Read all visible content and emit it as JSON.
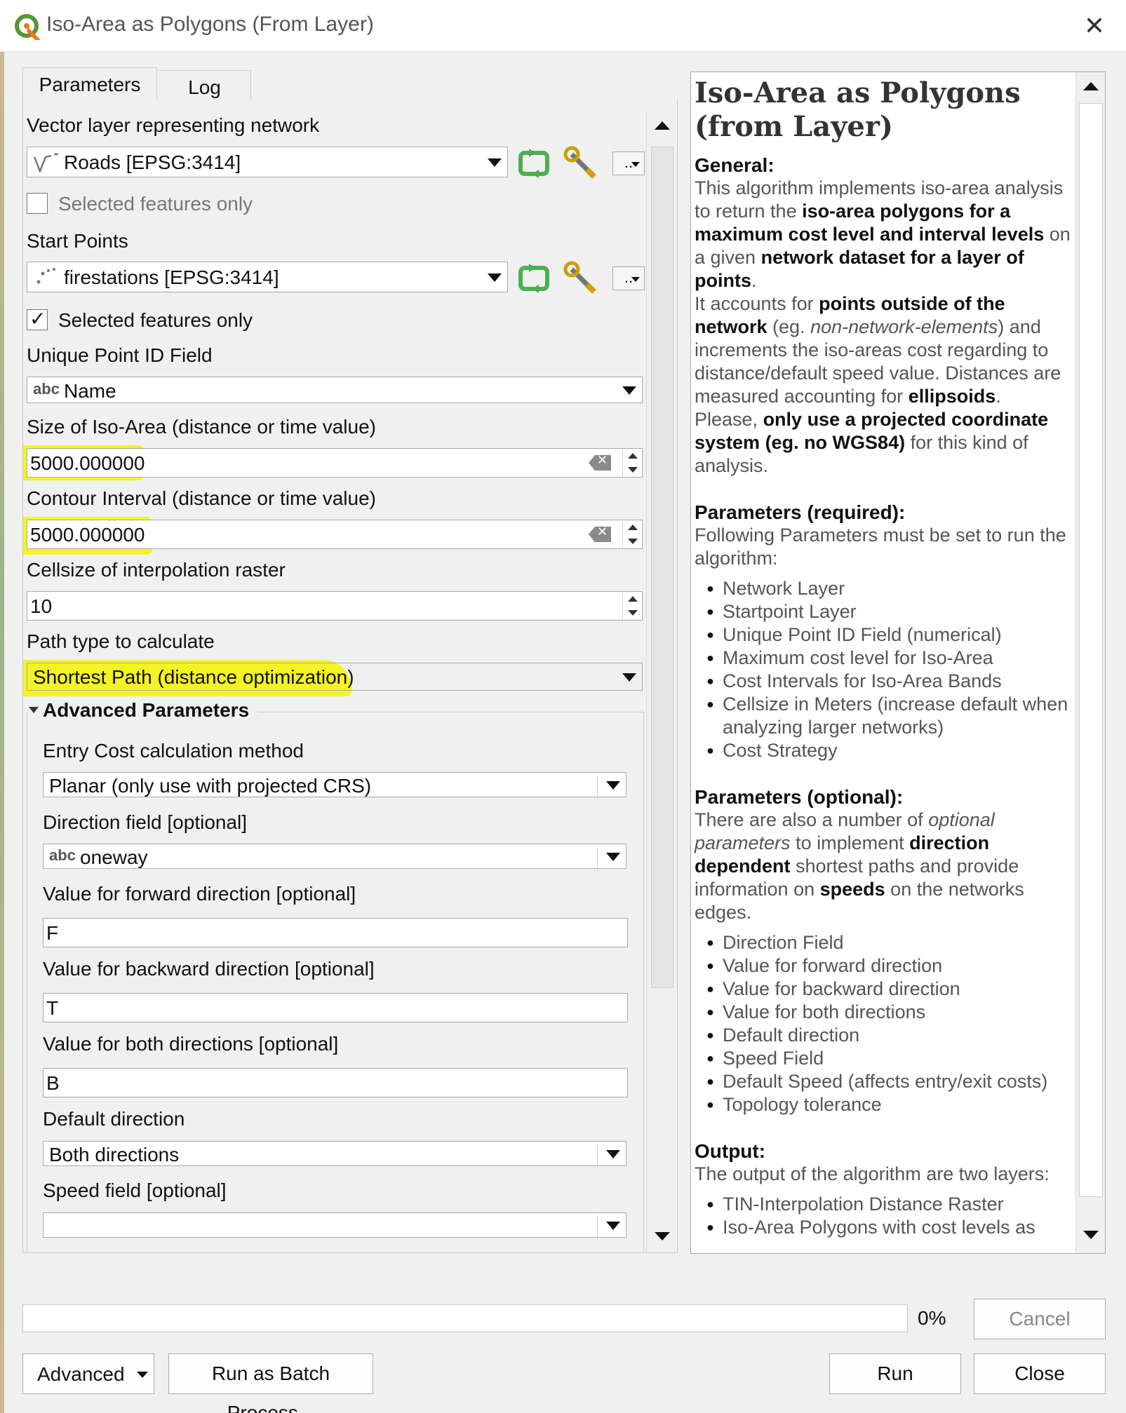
{
  "window": {
    "title": "Iso-Area as Polygons (From Layer)"
  },
  "tabs": [
    {
      "label": "Parameters",
      "active": true
    },
    {
      "label": "Log",
      "active": false
    }
  ],
  "params": {
    "network_label": "Vector layer representing network",
    "network_value": "Roads [EPSG:3414]",
    "network_selected_only_label": "Selected features only",
    "network_selected_only_checked": false,
    "start_points_label": "Start Points",
    "start_points_value": "firestations [EPSG:3414]",
    "start_selected_only_label": "Selected features only",
    "start_selected_only_checked": true,
    "uid_label": "Unique Point ID Field",
    "uid_type_tag": "abc",
    "uid_value": "Name",
    "size_label": "Size of Iso-Area (distance or time value)",
    "size_value": "5000.000000",
    "interval_label": "Contour Interval (distance or time value)",
    "interval_value": "5000.000000",
    "cellsize_label": "Cellsize of interpolation raster",
    "cellsize_value": "10",
    "path_type_label": "Path type to calculate",
    "path_type_value": "Shortest Path (distance optimization)",
    "more_button_label": "..",
    "highlight_color": "#f5f500"
  },
  "advanced": {
    "group_label": "Advanced Parameters",
    "entry_cost_label": "Entry Cost calculation method",
    "entry_cost_value": "Planar (only use with projected CRS)",
    "direction_field_label": "Direction field [optional]",
    "direction_field_type_tag": "abc",
    "direction_field_value": "oneway",
    "forward_label": "Value for forward direction [optional]",
    "forward_value": "F",
    "backward_label": "Value for backward direction [optional]",
    "backward_value": "T",
    "both_label": "Value for both directions [optional]",
    "both_value": "B",
    "default_direction_label": "Default direction",
    "default_direction_value": "Both directions",
    "speed_field_label": "Speed field [optional]",
    "speed_field_value": ""
  },
  "help": {
    "title": "Iso-Area as Polygons (from Layer)",
    "general_heading": "General:",
    "general_p1_a": "This algorithm implements iso-area analysis to return the ",
    "general_p1_b": "iso-area polygons for a maximum cost level and interval levels",
    "general_p1_c": " on a given ",
    "general_p1_d": "network dataset for a layer of points",
    "general_p1_e": ".",
    "general_p2_a": "It accounts for ",
    "general_p2_b": "points outside of the network",
    "general_p2_c": " (eg. ",
    "general_p2_d": "non-network-elements",
    "general_p2_e": ") and increments the iso-areas cost regarding to distance/default speed value. Distances are measured accounting for ",
    "general_p2_f": "ellipsoids",
    "general_p2_g": ".",
    "general_p3_a": "Please, ",
    "general_p3_b": "only use a projected coordinate system (eg. no WGS84)",
    "general_p3_c": " for this kind of analysis.",
    "required_heading": "Parameters (required):",
    "required_intro": "Following Parameters must be set to run the algorithm:",
    "required_items": [
      "Network Layer",
      "Startpoint Layer",
      "Unique Point ID Field (numerical)",
      "Maximum cost level for Iso-Area",
      "Cost Intervals for Iso-Area Bands",
      "Cellsize in Meters (increase default when analyzing larger networks)",
      "Cost Strategy"
    ],
    "optional_heading": "Parameters (optional):",
    "optional_a": "There are also a number of ",
    "optional_b": "optional parameters",
    "optional_c": " to implement ",
    "optional_d": "direction dependent",
    "optional_e": " shortest paths and provide information on ",
    "optional_f": "speeds",
    "optional_g": " on the networks edges.",
    "optional_items": [
      "Direction Field",
      "Value for forward direction",
      "Value for backward direction",
      "Value for both directions",
      "Default direction",
      "Speed Field",
      "Default Speed (affects entry/exit costs)",
      "Topology tolerance"
    ],
    "output_heading": "Output:",
    "output_intro": "The output of the algorithm are two layers:",
    "output_items": [
      "TIN-Interpolation Distance Raster",
      "Iso-Area Polygons with cost levels as"
    ]
  },
  "footer": {
    "progress_percent": 0,
    "progress_label": "0%",
    "cancel_label": "Cancel",
    "advanced_label": "Advanced",
    "batch_label": "Run as Batch Process...",
    "run_label": "Run",
    "close_label": "Close"
  }
}
